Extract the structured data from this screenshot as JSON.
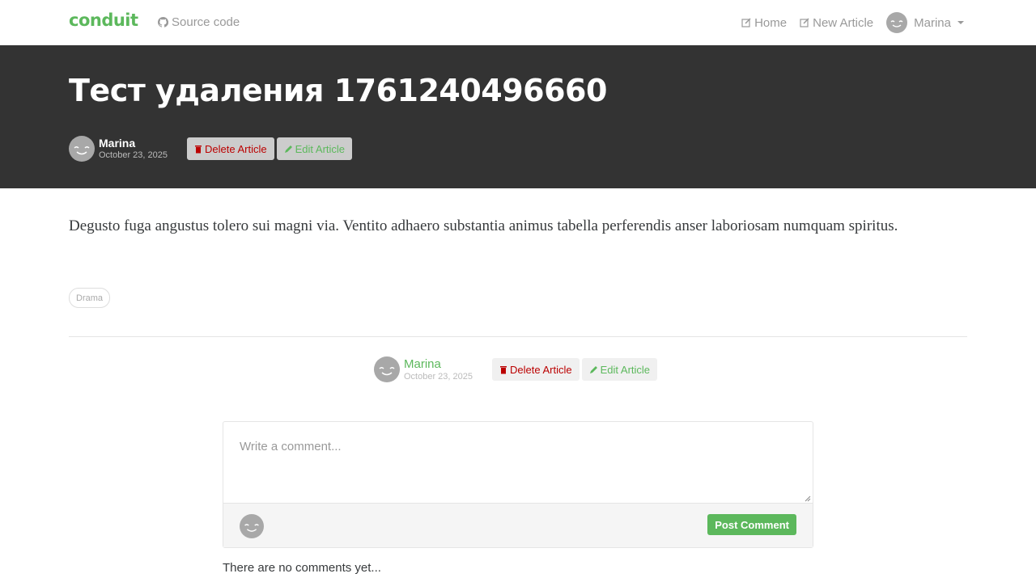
{
  "nav": {
    "brand": "conduit",
    "source_label": "Source code",
    "home_label": "Home",
    "new_article_label": "New Article",
    "user_label": "Marina"
  },
  "article": {
    "title": "Тест удаления 1761240496660",
    "author": "Marina",
    "date": "October 23, 2025",
    "body": "Degusto fuga angustus tolero sui magni via. Ventito adhaero substantia animus tabella perferendis anser laboriosam numquam spiritus.",
    "tags": [
      "Drama"
    ]
  },
  "actions": {
    "delete_label": "Delete Article",
    "edit_label": "Edit Article"
  },
  "comments": {
    "placeholder": "Write a comment...",
    "post_label": "Post Comment",
    "empty_text": "There are no comments yet..."
  },
  "colors": {
    "brand": "#5cb85c",
    "banner_bg": "#333333",
    "danger": "#b00000"
  }
}
